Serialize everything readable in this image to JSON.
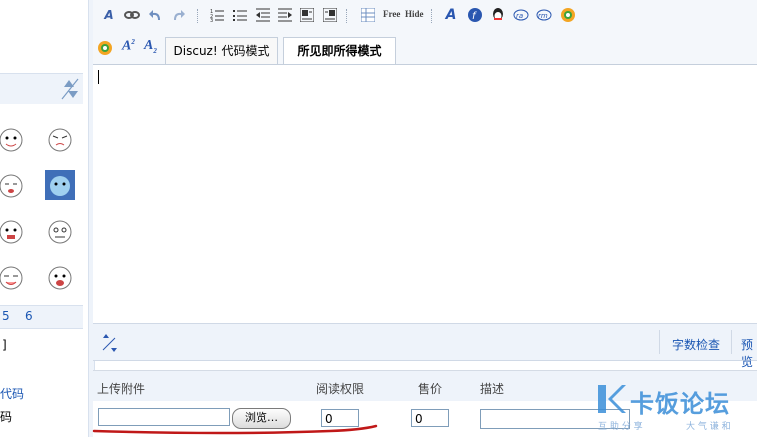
{
  "toolbar": {
    "row1_icons": [
      "remove-format-icon",
      "link-icon",
      "undo-icon",
      "redo-icon",
      "ordered-list-icon",
      "unordered-list-icon",
      "outdent-icon",
      "indent-icon",
      "align-left-icon",
      "align-right-icon",
      "table-icon",
      "free-tag-icon",
      "hide-tag-icon",
      "font-icon",
      "flash-icon",
      "qq-icon",
      "real-media-icon",
      "windows-media-icon",
      "media-icon"
    ],
    "free_label": "Free",
    "hide_label": "Hide"
  },
  "tabs": {
    "code_mode": "Discuz! 代码模式",
    "wysiwyg_mode": "所见即所得模式"
  },
  "status_bar": {
    "word_check": "字数检查",
    "preview": "预览"
  },
  "smilies": {
    "pager": [
      "5",
      "6"
    ]
  },
  "left_fragments": {
    "bracket": "]",
    "code": "代码",
    "ma": "码"
  },
  "attachment": {
    "col_upload": "上传附件",
    "col_read_perm": "阅读权限",
    "col_price": "售价",
    "col_desc": "描述",
    "browse_label": "浏览…",
    "read_perm_value": "0",
    "price_value": "0"
  },
  "watermark": {
    "brand": "卡饭论坛",
    "slogan_left": "互 助 分 享",
    "slogan_right": "大 气 谦 和",
    "color": "#3a8ed8"
  }
}
